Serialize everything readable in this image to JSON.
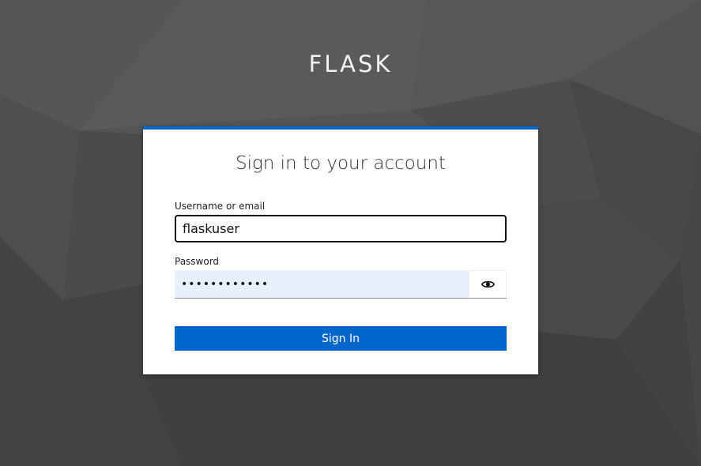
{
  "brand": {
    "title": "FLASK"
  },
  "login": {
    "heading": "Sign in to your account",
    "username_label": "Username or email",
    "username_value": "flaskuser",
    "password_label": "Password",
    "password_value": "••••••••••••",
    "submit_label": "Sign In"
  },
  "colors": {
    "accent": "#0066cc",
    "autofill": "#e8f0fe",
    "background": "#4a4a4a"
  },
  "icons": {
    "password_toggle": "eye-icon"
  }
}
